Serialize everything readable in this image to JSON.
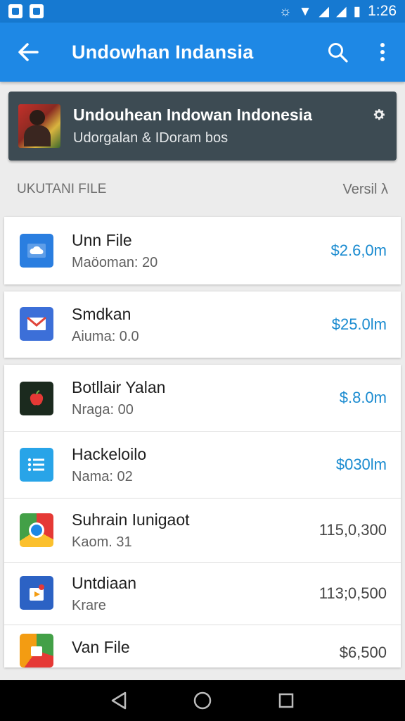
{
  "status_bar": {
    "time": "1:26"
  },
  "app_bar": {
    "title": "Undowhan Indansia"
  },
  "banner": {
    "title": "Undouhean Indowan Indonesia",
    "subtitle": "Udorgalan & IDoram bos"
  },
  "list_header": {
    "left": "UKUTANI FILE",
    "right": "Versil λ"
  },
  "items": [
    {
      "title": "Unn File",
      "subtitle": "Maöoman: 20",
      "value": "$2.6,0m",
      "icon": "cloud-folder-icon",
      "color": "#2a7ee0"
    },
    {
      "title": "Smdkan",
      "subtitle": "Aiuma: 0.0",
      "value": "$25.0lm",
      "icon": "mail-icon",
      "color": "#3c6fd8"
    },
    {
      "title": "Botllair Yalan",
      "subtitle": "Nraga: 00",
      "value": "$.8.0m",
      "icon": "apple-icon",
      "color": "#1b2a1e"
    },
    {
      "title": "Hackeloilo",
      "subtitle": "Nama: 02",
      "value": "$030lm",
      "icon": "list-icon",
      "color": "#28a4e8"
    },
    {
      "title": "Suhrain Iunigaot",
      "subtitle": "Kaom. 31",
      "value": "115,0,300",
      "icon": "chrome-icon",
      "color": "#e04a2e"
    },
    {
      "title": "Untdiaan",
      "subtitle": "Krare",
      "value": "113;0,500",
      "icon": "play-store-icon",
      "color": "#2c62c4"
    },
    {
      "title": "Van File",
      "subtitle": "",
      "value": "$6,500",
      "icon": "colorful-app-icon",
      "color": "#e0763c"
    }
  ]
}
